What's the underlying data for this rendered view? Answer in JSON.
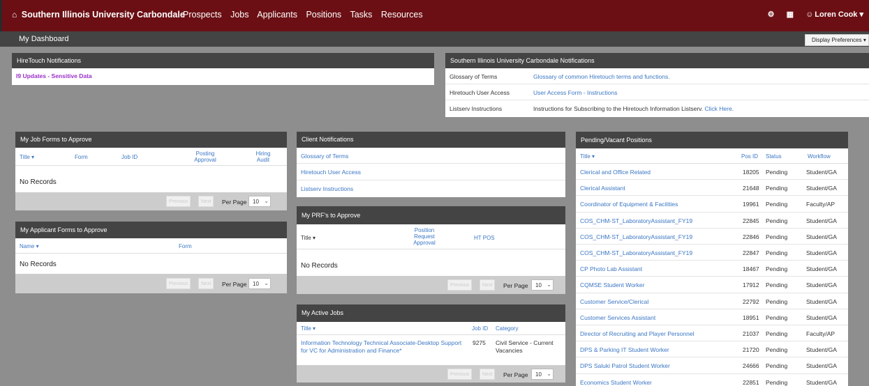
{
  "nav": {
    "home_icon": "home-icon",
    "brand": "Southern Illinois University Carbondale",
    "items": [
      "Prospects",
      "Jobs",
      "Applicants",
      "Positions",
      "Tasks",
      "Resources"
    ],
    "gear": "⚙",
    "grid": "▦",
    "user": "Loren Cook"
  },
  "subbar": {
    "title": "My Dashboard",
    "display_prefs": "Display Preferences"
  },
  "hiretouch": {
    "title": "HireTouch Notifications",
    "item": "I9 Updates - Sensitive Data"
  },
  "siuc_notifications": {
    "title": "Southern Illinois University Carbondale Notifications",
    "rows": [
      {
        "label": "Glossary of Terms",
        "text": "Glossary of common Hiretouch terms and functions.",
        "link": ""
      },
      {
        "label": "Hiretouch User Access",
        "text": "User Access Form - Instructions",
        "link": ""
      },
      {
        "label": "Listserv Instructions",
        "text": "Instructions for Subscribing to the Hiretouch Information Listserv. ",
        "link": "Click Here."
      }
    ]
  },
  "job_forms": {
    "title": "My Job Forms to Approve",
    "cols": {
      "title": "Title ▾",
      "form": "Form",
      "job_id": "Job ID",
      "posting": "Posting Approval",
      "hiring": "Hiring Audit"
    },
    "empty": "No Records"
  },
  "applicant_forms": {
    "title": "My Applicant Forms to Approve",
    "cols": {
      "name": "Name ▾",
      "form": "Form"
    },
    "empty": "No Records"
  },
  "pager": {
    "previous": "Previous",
    "next": "Next",
    "per_page": "Per Page",
    "per_page_value": "10"
  },
  "client_notifications": {
    "title": "Client Notifications",
    "items": [
      "Glossary of Terms",
      "Hiretouch User Access",
      "Listserv Instructions"
    ]
  },
  "prf": {
    "title": "My PRF's to Approve",
    "cols": {
      "title": "Title ▾",
      "position": "Position Request Approval",
      "ht_pos": "HT POS"
    },
    "empty": "No Records"
  },
  "active_jobs": {
    "title": "My Active Jobs",
    "cols": {
      "title": "Title ▾",
      "job_id": "Job ID",
      "category": "Category"
    },
    "rows": [
      {
        "title": "Information Technology Technical Associate-Desktop Support for VC for Administration and Finance*",
        "job_id": "9275",
        "category": "Civil Service - Current Vacancies"
      }
    ]
  },
  "pending": {
    "title": "Pending/Vacant Positions",
    "cols": {
      "title": "Title ▾",
      "pos_id": "Pos ID",
      "status": "Status",
      "workflow": "Workflow"
    },
    "rows": [
      {
        "title": "Clerical and Office Related",
        "pos_id": "18205",
        "status": "Pending",
        "workflow": "Student/GA"
      },
      {
        "title": "Clerical Assistant",
        "pos_id": "21648",
        "status": "Pending",
        "workflow": "Student/GA"
      },
      {
        "title": "Coordinator of Equipment & Facilities",
        "pos_id": "19961",
        "status": "Pending",
        "workflow": "Faculty/AP"
      },
      {
        "title": "COS_CHM-ST_LaboratoryAssistant_FY19",
        "pos_id": "22845",
        "status": "Pending",
        "workflow": "Student/GA"
      },
      {
        "title": "COS_CHM-ST_LaboratoryAssistant_FY19",
        "pos_id": "22846",
        "status": "Pending",
        "workflow": "Student/GA"
      },
      {
        "title": "COS_CHM-ST_LaboratoryAssistant_FY19",
        "pos_id": "22847",
        "status": "Pending",
        "workflow": "Student/GA"
      },
      {
        "title": "CP Photo Lab Assistant",
        "pos_id": "18467",
        "status": "Pending",
        "workflow": "Student/GA"
      },
      {
        "title": "CQMSE Student Worker",
        "pos_id": "17912",
        "status": "Pending",
        "workflow": "Student/GA"
      },
      {
        "title": "Customer Service/Clerical",
        "pos_id": "22792",
        "status": "Pending",
        "workflow": "Student/GA"
      },
      {
        "title": "Customer Services Assistant",
        "pos_id": "18951",
        "status": "Pending",
        "workflow": "Student/GA"
      },
      {
        "title": "Director of Recruiting and Player Personnel",
        "pos_id": "21037",
        "status": "Pending",
        "workflow": "Faculty/AP"
      },
      {
        "title": "DPS & Parking IT Student Worker",
        "pos_id": "21720",
        "status": "Pending",
        "workflow": "Student/GA"
      },
      {
        "title": "DPS Saluki Patrol Student Worker",
        "pos_id": "24666",
        "status": "Pending",
        "workflow": "Student/GA"
      },
      {
        "title": "Economics Student Worker",
        "pos_id": "22851",
        "status": "Pending",
        "workflow": "Student/GA"
      }
    ]
  }
}
